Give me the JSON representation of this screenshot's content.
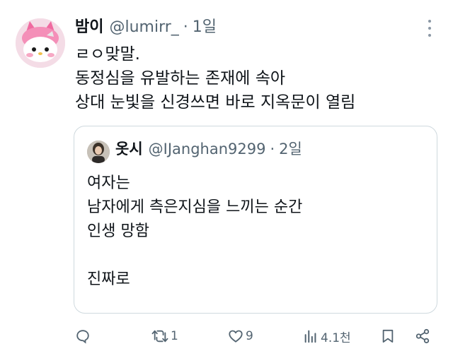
{
  "author": {
    "display_name": "밤이",
    "handle": "@lumirr_",
    "separator": "·",
    "time": "1일"
  },
  "tweet_text": [
    "ㄹㅇ맞말.",
    "동정심을 유발하는 존재에 속아",
    "상대 눈빛을 신경쓰면 바로 지옥문이 열림"
  ],
  "quoted_tweet": {
    "display_name": "옷시",
    "handle": "@IJanghan9299",
    "separator": "·",
    "time": "2일",
    "lines": [
      "여자는",
      "남자에게 측은지심을 느끼는 순간",
      "인생 망함",
      "",
      "진짜로"
    ]
  },
  "actions": {
    "reply_count": "",
    "retweet_count": "1",
    "like_count": "9",
    "views_count": "4.1천"
  },
  "icons": {
    "more": "more-dots-icon",
    "reply": "reply-icon",
    "retweet": "retweet-icon",
    "like": "heart-icon",
    "views": "views-bar-chart-icon",
    "bookmark": "bookmark-icon",
    "share": "share-icon"
  },
  "colors": {
    "text_primary": "#0f1419",
    "text_secondary": "#536471",
    "border": "#cfd9de"
  }
}
